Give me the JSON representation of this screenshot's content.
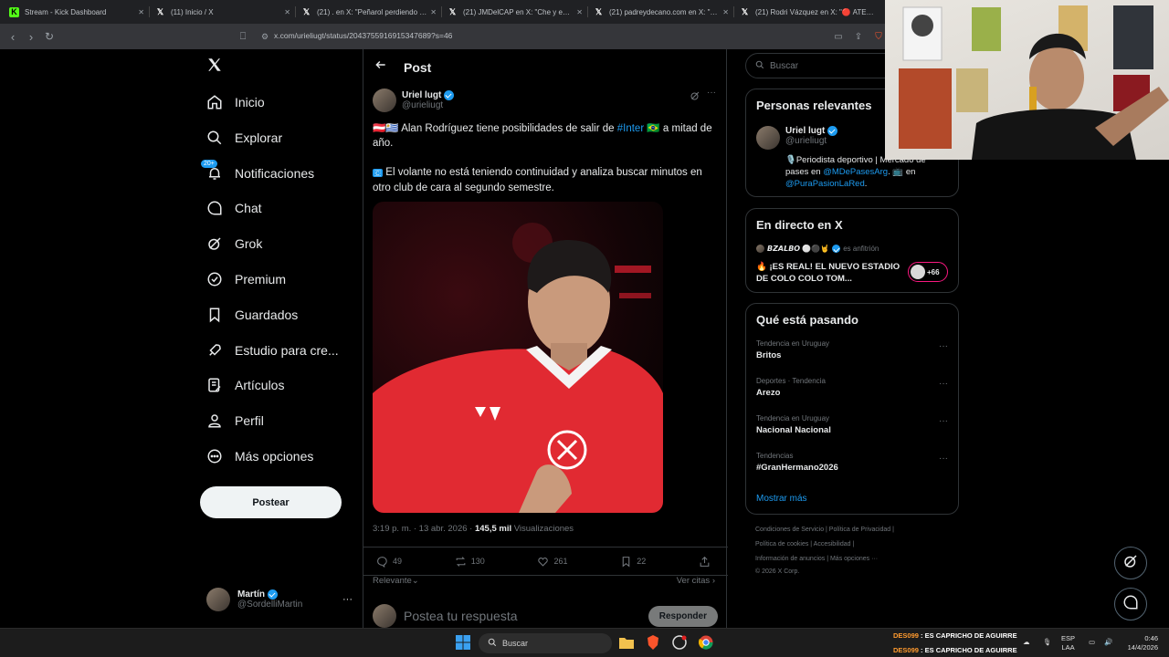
{
  "browser": {
    "tabs": [
      {
        "title": "Stream - Kick Dashboard",
        "icon": "kick-icon"
      },
      {
        "title": "(11) Inicio / X",
        "icon": "x-icon"
      },
      {
        "title": "(21) . en X: \"Peñarol perdiendo por...",
        "icon": "x-icon"
      },
      {
        "title": "(21) JMDelCAP en X: \"Che y eso? ht...",
        "icon": "x-icon"
      },
      {
        "title": "(21) padreydecano.com en X: \"Minu...",
        "icon": "x-icon"
      },
      {
        "title": "(21) Rodri Vázquez en X: \"🔴 ATEN...",
        "icon": "x-icon"
      }
    ],
    "url": "x.com/urieliugt/status/2043755916915347689?s=46"
  },
  "sidebar": {
    "items": [
      {
        "label": "Inicio",
        "icon": "home-icon"
      },
      {
        "label": "Explorar",
        "icon": "search-icon"
      },
      {
        "label": "Notificaciones",
        "icon": "bell-icon",
        "badge": "20+"
      },
      {
        "label": "Chat",
        "icon": "chat-icon"
      },
      {
        "label": "Grok",
        "icon": "grok-icon"
      },
      {
        "label": "Premium",
        "icon": "premium-icon"
      },
      {
        "label": "Guardados",
        "icon": "bookmark-icon"
      },
      {
        "label": "Estudio para cre...",
        "icon": "rocket-icon"
      },
      {
        "label": "Artículos",
        "icon": "article-icon"
      },
      {
        "label": "Perfil",
        "icon": "person-icon"
      },
      {
        "label": "Más opciones",
        "icon": "more-circle-icon"
      }
    ],
    "post_label": "Postear",
    "account": {
      "name": "Martín",
      "handle": "@SordelliMartin"
    }
  },
  "post": {
    "header": "Post",
    "author": {
      "name": "Uriel lugt",
      "handle": "@urieliugt"
    },
    "para1_flags": "🇦🇹🇺🇾",
    "para1_a": "Alan Rodríguez tiene posibilidades de salir de ",
    "para1_link": "#Inter",
    "para1_flag2": "🇧🇷",
    "para1_b": " a mitad de año.",
    "para2_icon": "🇨",
    "para2": " El volante no está teniendo continuidad y analiza buscar minutos en otro club de cara al segundo semestre.",
    "timestamp": "3:19 p. m. · 13 abr. 2026 · ",
    "views_count": "145,5 mil",
    "views_label": " Visualizaciones",
    "stats": {
      "replies": "49",
      "reposts": "130",
      "likes": "261",
      "bookmarks": "22"
    },
    "relevant_label": "Relevante",
    "quotes_label": "Ver citas",
    "reply_placeholder": "Postea tu respuesta",
    "reply_button": "Responder"
  },
  "right": {
    "search_placeholder": "Buscar",
    "relevant_people": {
      "title": "Personas relevantes",
      "name": "Uriel lugt",
      "handle": "@urieliugt",
      "bio_a": "🎙️Periodista deportivo | Mercado de pases en ",
      "bio_link1": "@MDePasesArg",
      "bio_b": ". 📺 en ",
      "bio_link2": "@PuraPasionLaRed",
      "bio_c": "."
    },
    "live": {
      "title": "En directo en X",
      "host": "𝘽𝙕𝘼𝙇𝘽𝙊 ⚪⚫🤘",
      "host_label": "es anfitrión",
      "text": "🔥 ¡ES REAL! EL NUEVO ESTADIO DE COLO COLO TOM...",
      "listeners": "+66"
    },
    "trends": {
      "title": "Qué está pasando",
      "items": [
        {
          "category": "Tendencia en Uruguay",
          "topic": "Britos"
        },
        {
          "category": "Deportes · Tendencia",
          "topic": "Arezo"
        },
        {
          "category": "Tendencia en Uruguay",
          "topic": "Nacional Nacional"
        },
        {
          "category": "Tendencias",
          "topic": "#GranHermano2026"
        }
      ],
      "show_more": "Mostrar más"
    },
    "footer": {
      "l1": "Condiciones de Servicio  |  Política de Privacidad  |",
      "l2": "Política de cookies  |  Accesibilidad  |",
      "l3": "Información de anuncios  |  Más opciones ···",
      "l4": "© 2026 X Corp."
    }
  },
  "taskbar": {
    "search": "Buscar",
    "ticker_line1_a": "DES099",
    "ticker_line1_b": " : ES CAPRICHO DE AGUIRRE",
    "ticker_line2_a": "DES099",
    "ticker_line2_b": " : ES CAPRICHO DE AGUIRRE",
    "lang1": "ESP",
    "lang2": "LAA",
    "time": "0:46",
    "date": "14/4/2026"
  },
  "colors": {
    "accent": "#1d9bf0",
    "bg": "#000000",
    "border": "#2f3336",
    "muted": "#71767b"
  }
}
